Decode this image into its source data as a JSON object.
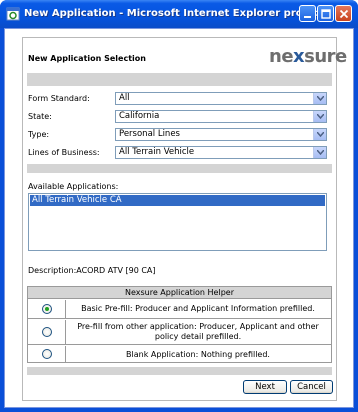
{
  "window": {
    "title": "New Application - Microsoft Internet Explorer provided ...",
    "accent": "#0a5ae6"
  },
  "header": {
    "title": "New Application Selection",
    "logo_prefix": "ne",
    "logo_x": "x",
    "logo_suffix": "sure"
  },
  "form": {
    "fields": [
      {
        "label": "Form Standard:",
        "value": "All"
      },
      {
        "label": "State:",
        "value": "California"
      },
      {
        "label": "Type:",
        "value": "Personal Lines"
      },
      {
        "label": "Lines of Business:",
        "value": "All Terrain Vehicle"
      }
    ],
    "available_label": "Available Applications:",
    "available_items": [
      "All Terrain Vehicle CA"
    ],
    "description": "Description:ACORD ATV [90 CA]"
  },
  "helper": {
    "title": "Nexsure Application Helper",
    "options": [
      {
        "text": "Basic Pre-fill: Producer and Applicant Information prefilled.",
        "selected": true
      },
      {
        "text": "Pre-fill from other application: Producer, Applicant and other policy detail prefilled.",
        "selected": false
      },
      {
        "text": "Blank Application: Nothing prefilled.",
        "selected": false
      }
    ]
  },
  "buttons": {
    "next": "Next",
    "cancel": "Cancel"
  }
}
